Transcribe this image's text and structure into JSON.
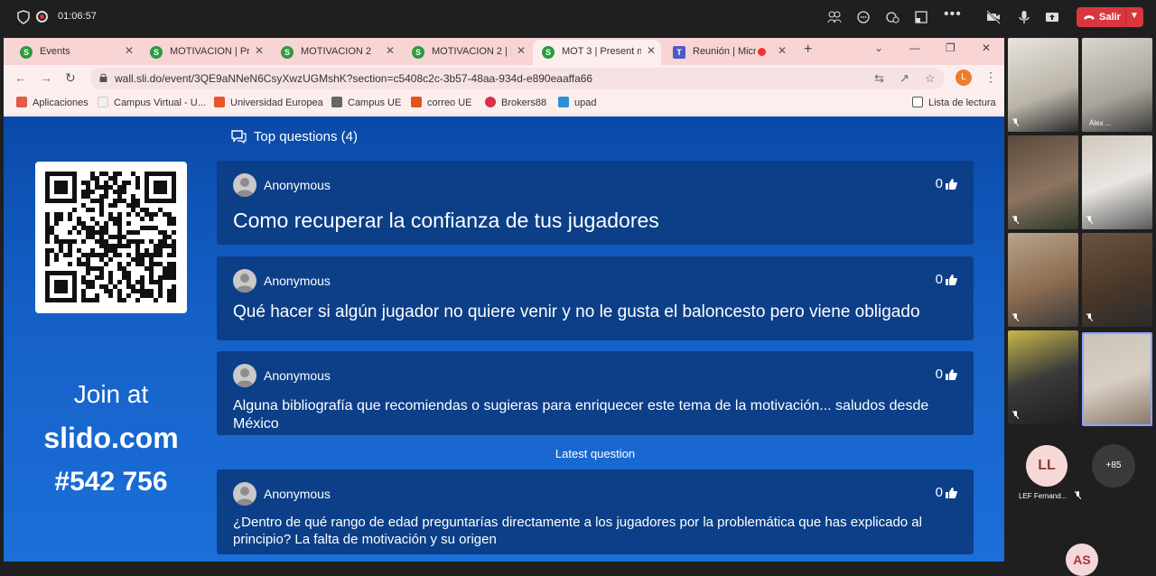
{
  "meeting": {
    "timer": "01:06:57",
    "leave_label": "Salir"
  },
  "browser": {
    "tabs": [
      {
        "label": "Events",
        "favicon": "S"
      },
      {
        "label": "MOTIVACION | Pre",
        "favicon": "S"
      },
      {
        "label": "MOTIVACION 2",
        "favicon": "S"
      },
      {
        "label": "MOTIVACION 2 | Pr",
        "favicon": "S"
      },
      {
        "label": "MOT 3 | Present m",
        "favicon": "S"
      },
      {
        "label": "Reunión | Micr",
        "favicon": "T"
      }
    ],
    "url": "wall.sli.do/event/3QE9aNNeN6CsyXwzUGMshK?section=c5408c2c-3b57-48aa-934d-e890eaaffa66",
    "profile_initial": "L",
    "bookmarks": [
      {
        "label": "Aplicaciones",
        "color": "#e15b45"
      },
      {
        "label": "Campus Virtual - U...",
        "color": "#f1f1f1"
      },
      {
        "label": "Universidad Europea",
        "color": "#e8572a"
      },
      {
        "label": "Campus UE",
        "color": "#666666"
      },
      {
        "label": "correo UE",
        "color": "#e3541c"
      },
      {
        "label": "Brokers88",
        "color": "#d9304a"
      },
      {
        "label": "upad",
        "color": "#2f8fd8"
      }
    ],
    "reading_list": "Lista de lectura"
  },
  "slido": {
    "join_at": "Join at",
    "domain": "slido.com",
    "code": "#542 756",
    "top_questions": "Top questions (4)",
    "latest_label": "Latest question",
    "questions": [
      {
        "author": "Anonymous",
        "likes": "0",
        "text": "Como recuperar la confianza de tus jugadores"
      },
      {
        "author": "Anonymous",
        "likes": "0",
        "text": "Qué hacer si algún jugador no quiere venir y no le gusta el baloncesto pero viene obligado"
      },
      {
        "author": "Anonymous",
        "likes": "0",
        "text": "Alguna bibliografía que recomiendas o sugieras para enriquecer este tema de la motivación... saludos desde México"
      }
    ],
    "latest": {
      "author": "Anonymous",
      "likes": "0",
      "text": "¿Dentro de qué rango de edad preguntarías directamente a los jugadores por la problemática que has explicado al principio? La falta de motivación y su origen"
    }
  },
  "participants": {
    "tile_name_alex": "Álex ...",
    "ll_initials": "LL",
    "ll_name": "LEF Fernand...",
    "more_count": "+85",
    "as_initials": "AS"
  }
}
